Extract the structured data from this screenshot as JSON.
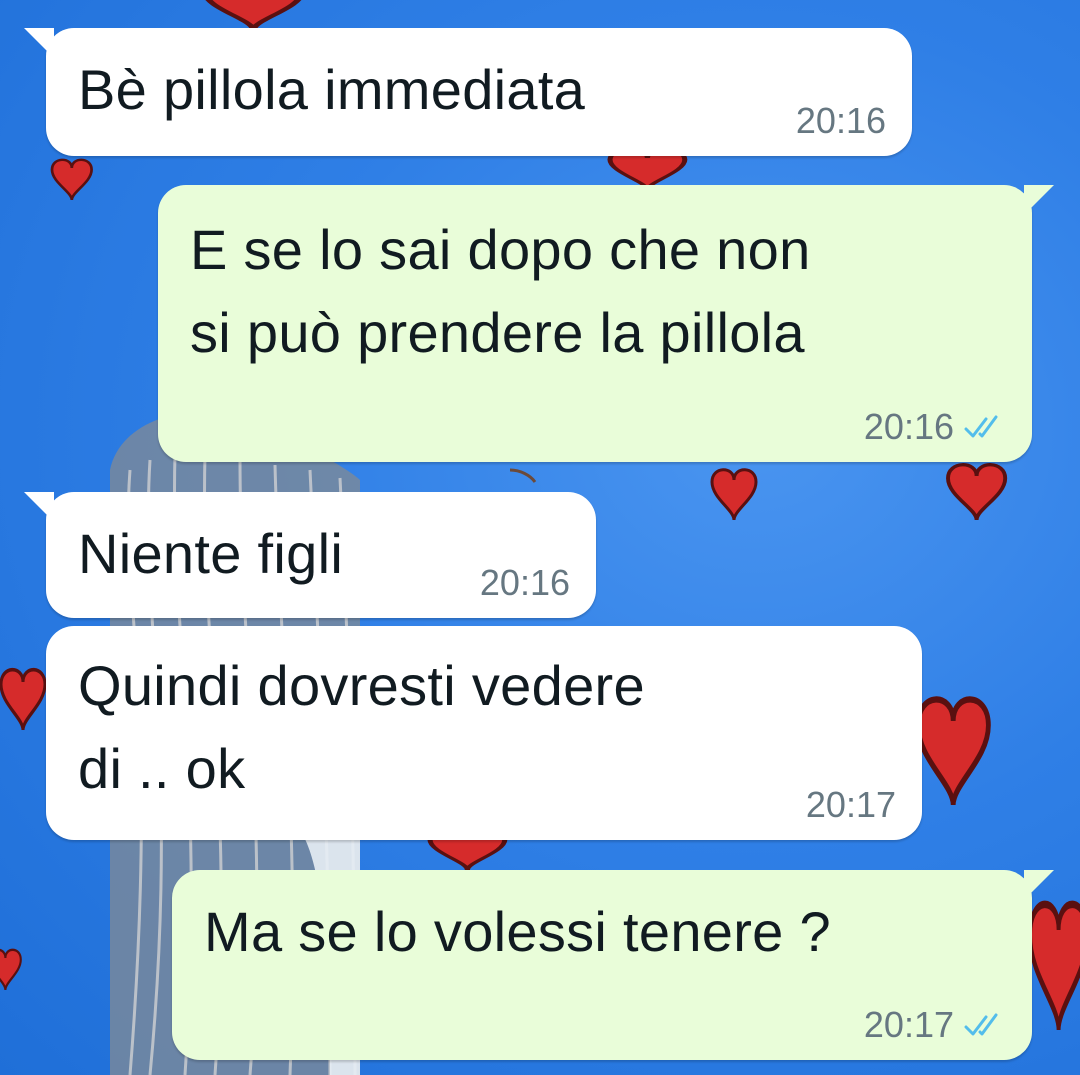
{
  "messages": [
    {
      "direction": "incoming",
      "text": "Bè pillola immediata",
      "time": "20:16"
    },
    {
      "direction": "outgoing",
      "text": "E se lo sai dopo che non\nsi può prendere la pillola",
      "time": "20:16",
      "status": "read"
    },
    {
      "direction": "incoming",
      "text": "Niente figli",
      "time": "20:16"
    },
    {
      "direction": "incoming",
      "text": "Quindi dovresti vedere\ndi .. ok",
      "time": "20:17"
    },
    {
      "direction": "outgoing",
      "text": "Ma se lo volessi tenere ?",
      "time": "20:17",
      "status": "read"
    }
  ],
  "colors": {
    "incoming_bubble": "#ffffff",
    "outgoing_bubble": "#e9fdd9",
    "read_ticks": "#53bdeb",
    "wallpaper": "#2f7fe6",
    "hearts": "#d32f2f"
  },
  "icons": {
    "read_status": "double-check-icon",
    "wallpaper": "hearts-wallpaper"
  }
}
